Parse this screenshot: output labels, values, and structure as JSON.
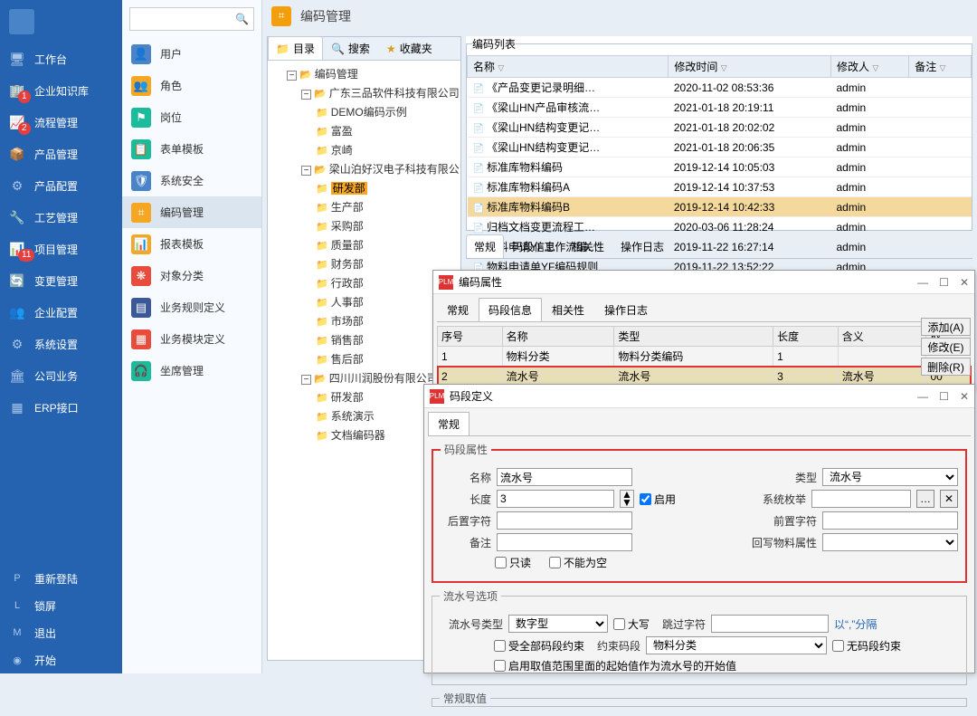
{
  "page_title": "编码管理",
  "nav_primary": {
    "items": [
      {
        "icon": "🖥",
        "label": "工作台"
      },
      {
        "icon": "🏢",
        "label": "企业知识库",
        "badge": "1"
      },
      {
        "icon": "📈",
        "label": "流程管理",
        "badge": "2"
      },
      {
        "icon": "📦",
        "label": "产品管理"
      },
      {
        "icon": "⚙",
        "label": "产品配置"
      },
      {
        "icon": "🔧",
        "label": "工艺管理"
      },
      {
        "icon": "📊",
        "label": "项目管理",
        "badge": "11"
      },
      {
        "icon": "🔄",
        "label": "变更管理"
      },
      {
        "icon": "👥",
        "label": "企业配置"
      },
      {
        "icon": "⚙",
        "label": "系统设置"
      },
      {
        "icon": "🏛",
        "label": "公司业务"
      },
      {
        "icon": "▦",
        "label": "ERP接口"
      }
    ],
    "bottom": [
      {
        "icon": "P",
        "label": "重新登陆"
      },
      {
        "icon": "L",
        "label": "锁屏"
      },
      {
        "icon": "M",
        "label": "退出"
      },
      {
        "icon": "◉",
        "label": "开始"
      }
    ]
  },
  "nav_secondary": {
    "search_placeholder": "",
    "search_icon": "🔍",
    "items": [
      {
        "color": "#4a84c8",
        "icon": "👤",
        "label": "用户"
      },
      {
        "color": "#f5a623",
        "icon": "👥",
        "label": "角色"
      },
      {
        "color": "#1abc9c",
        "icon": "⚑",
        "label": "岗位"
      },
      {
        "color": "#1abc9c",
        "icon": "📋",
        "label": "表单模板"
      },
      {
        "color": "#4a84c8",
        "icon": "🛡",
        "label": "系统安全"
      },
      {
        "color": "#f5a623",
        "icon": "⌗",
        "label": "编码管理",
        "active": true
      },
      {
        "color": "#f5a623",
        "icon": "📊",
        "label": "报表模板"
      },
      {
        "color": "#e74c3c",
        "icon": "❋",
        "label": "对象分类"
      },
      {
        "color": "#3b5998",
        "icon": "▤",
        "label": "业务规则定义"
      },
      {
        "color": "#e74c3c",
        "icon": "▦",
        "label": "业务模块定义"
      },
      {
        "color": "#1abc9c",
        "icon": "🎧",
        "label": "坐席管理"
      }
    ]
  },
  "tree_tabs": [
    {
      "icon": "📁",
      "label": "目录",
      "active": true
    },
    {
      "icon": "🔍",
      "label": "搜索",
      "color": "#2e8b57"
    },
    {
      "icon": "★",
      "label": "收藏夹",
      "color": "#d4a017"
    }
  ],
  "tree": {
    "root": "编码管理",
    "nodes": [
      {
        "label": "广东三品软件科技有限公司",
        "open": true,
        "children": [
          {
            "label": "DEMO编码示例"
          },
          {
            "label": "富盈"
          },
          {
            "label": "京崎"
          }
        ]
      },
      {
        "label": "梁山泊好汉电子科技有限公司",
        "open": true,
        "children": [
          {
            "label": "研发部",
            "selected": true
          },
          {
            "label": "生产部"
          },
          {
            "label": "采购部"
          },
          {
            "label": "质量部"
          },
          {
            "label": "财务部"
          },
          {
            "label": "行政部"
          },
          {
            "label": "人事部"
          },
          {
            "label": "市场部"
          },
          {
            "label": "销售部"
          },
          {
            "label": "售后部"
          }
        ]
      },
      {
        "label": "四川川润股份有限公司",
        "open": true,
        "children": [
          {
            "label": "研发部"
          },
          {
            "label": "系统演示"
          },
          {
            "label": "文档编码器"
          }
        ]
      }
    ]
  },
  "list": {
    "title": "编码列表",
    "headers": [
      "名称",
      "修改时间",
      "修改人",
      "备注"
    ],
    "rows": [
      {
        "name": "《产品变更记录明细…",
        "time": "2020-11-02 08:53:36",
        "user": "admin"
      },
      {
        "name": "《梁山HN产品审核流…",
        "time": "2021-01-18 20:19:11",
        "user": "admin"
      },
      {
        "name": "《梁山HN结构变更记…",
        "time": "2021-01-18 20:02:02",
        "user": "admin"
      },
      {
        "name": "《梁山HN结构变更记…",
        "time": "2021-01-18 20:06:35",
        "user": "admin"
      },
      {
        "name": "标准库物料编码",
        "time": "2019-12-14 10:05:03",
        "user": "admin"
      },
      {
        "name": "标准库物料编码A",
        "time": "2019-12-14 10:37:53",
        "user": "admin"
      },
      {
        "name": "标准库物料编码B",
        "time": "2019-12-14 10:42:33",
        "user": "admin",
        "selected": true
      },
      {
        "name": "归档文档变更流程工…",
        "time": "2020-03-06 11:28:24",
        "user": "admin"
      },
      {
        "name": "物料申请YF工作流编…",
        "time": "2019-11-22 16:27:14",
        "user": "admin"
      },
      {
        "name": "物料申请单YF编码规则",
        "time": "2019-11-22 13:52:22",
        "user": "admin"
      }
    ]
  },
  "detail_tabs": [
    "常规",
    "码段信息",
    "相关性",
    "操作日志"
  ],
  "dialog1": {
    "title": "编码属性",
    "tabs": [
      "常规",
      "码段信息",
      "相关性",
      "操作日志"
    ],
    "active_tab": 1,
    "headers": [
      "序号",
      "名称",
      "类型",
      "长度",
      "含义",
      "取"
    ],
    "rows": [
      {
        "idx": "1",
        "name": "物料分类",
        "type": "物料分类编码",
        "len": "1",
        "mean": ""
      },
      {
        "idx": "2",
        "name": "流水号",
        "type": "流水号",
        "len": "3",
        "mean": "流水号",
        "tail": "00",
        "selected": true
      }
    ],
    "buttons": [
      "添加(A)",
      "修改(E)",
      "删除(R)"
    ]
  },
  "dialog2": {
    "title": "码段定义",
    "tab": "常规",
    "group1": "码段属性",
    "fields": {
      "name_label": "名称",
      "name_val": "流水号",
      "type_label": "类型",
      "type_val": "流水号",
      "len_label": "长度",
      "len_val": "3",
      "enable_label": "启用",
      "enum_label": "系统枚举",
      "enum_val": "",
      "suffix_label": "后置字符",
      "suffix_val": "",
      "prefix_label": "前置字符",
      "prefix_val": "",
      "remark_label": "备注",
      "remark_val": "",
      "writeback_label": "回写物料属性",
      "writeback_val": "",
      "readonly_label": "只读",
      "notempty_label": "不能为空"
    },
    "group2": "流水号选项",
    "serial": {
      "type_label": "流水号类型",
      "type_val": "数字型",
      "upper_label": "大写",
      "skip_label": "跳过字符",
      "skip_val": "",
      "sep_label": "以“,”分隔",
      "allseg_label": "受全部码段约束",
      "seg_label": "约束码段",
      "seg_val": "物料分类",
      "noseg_label": "无码段约束",
      "range_label": "启用取值范围里面的起始值作为流水号的开始值"
    },
    "group3": "常规取值"
  }
}
